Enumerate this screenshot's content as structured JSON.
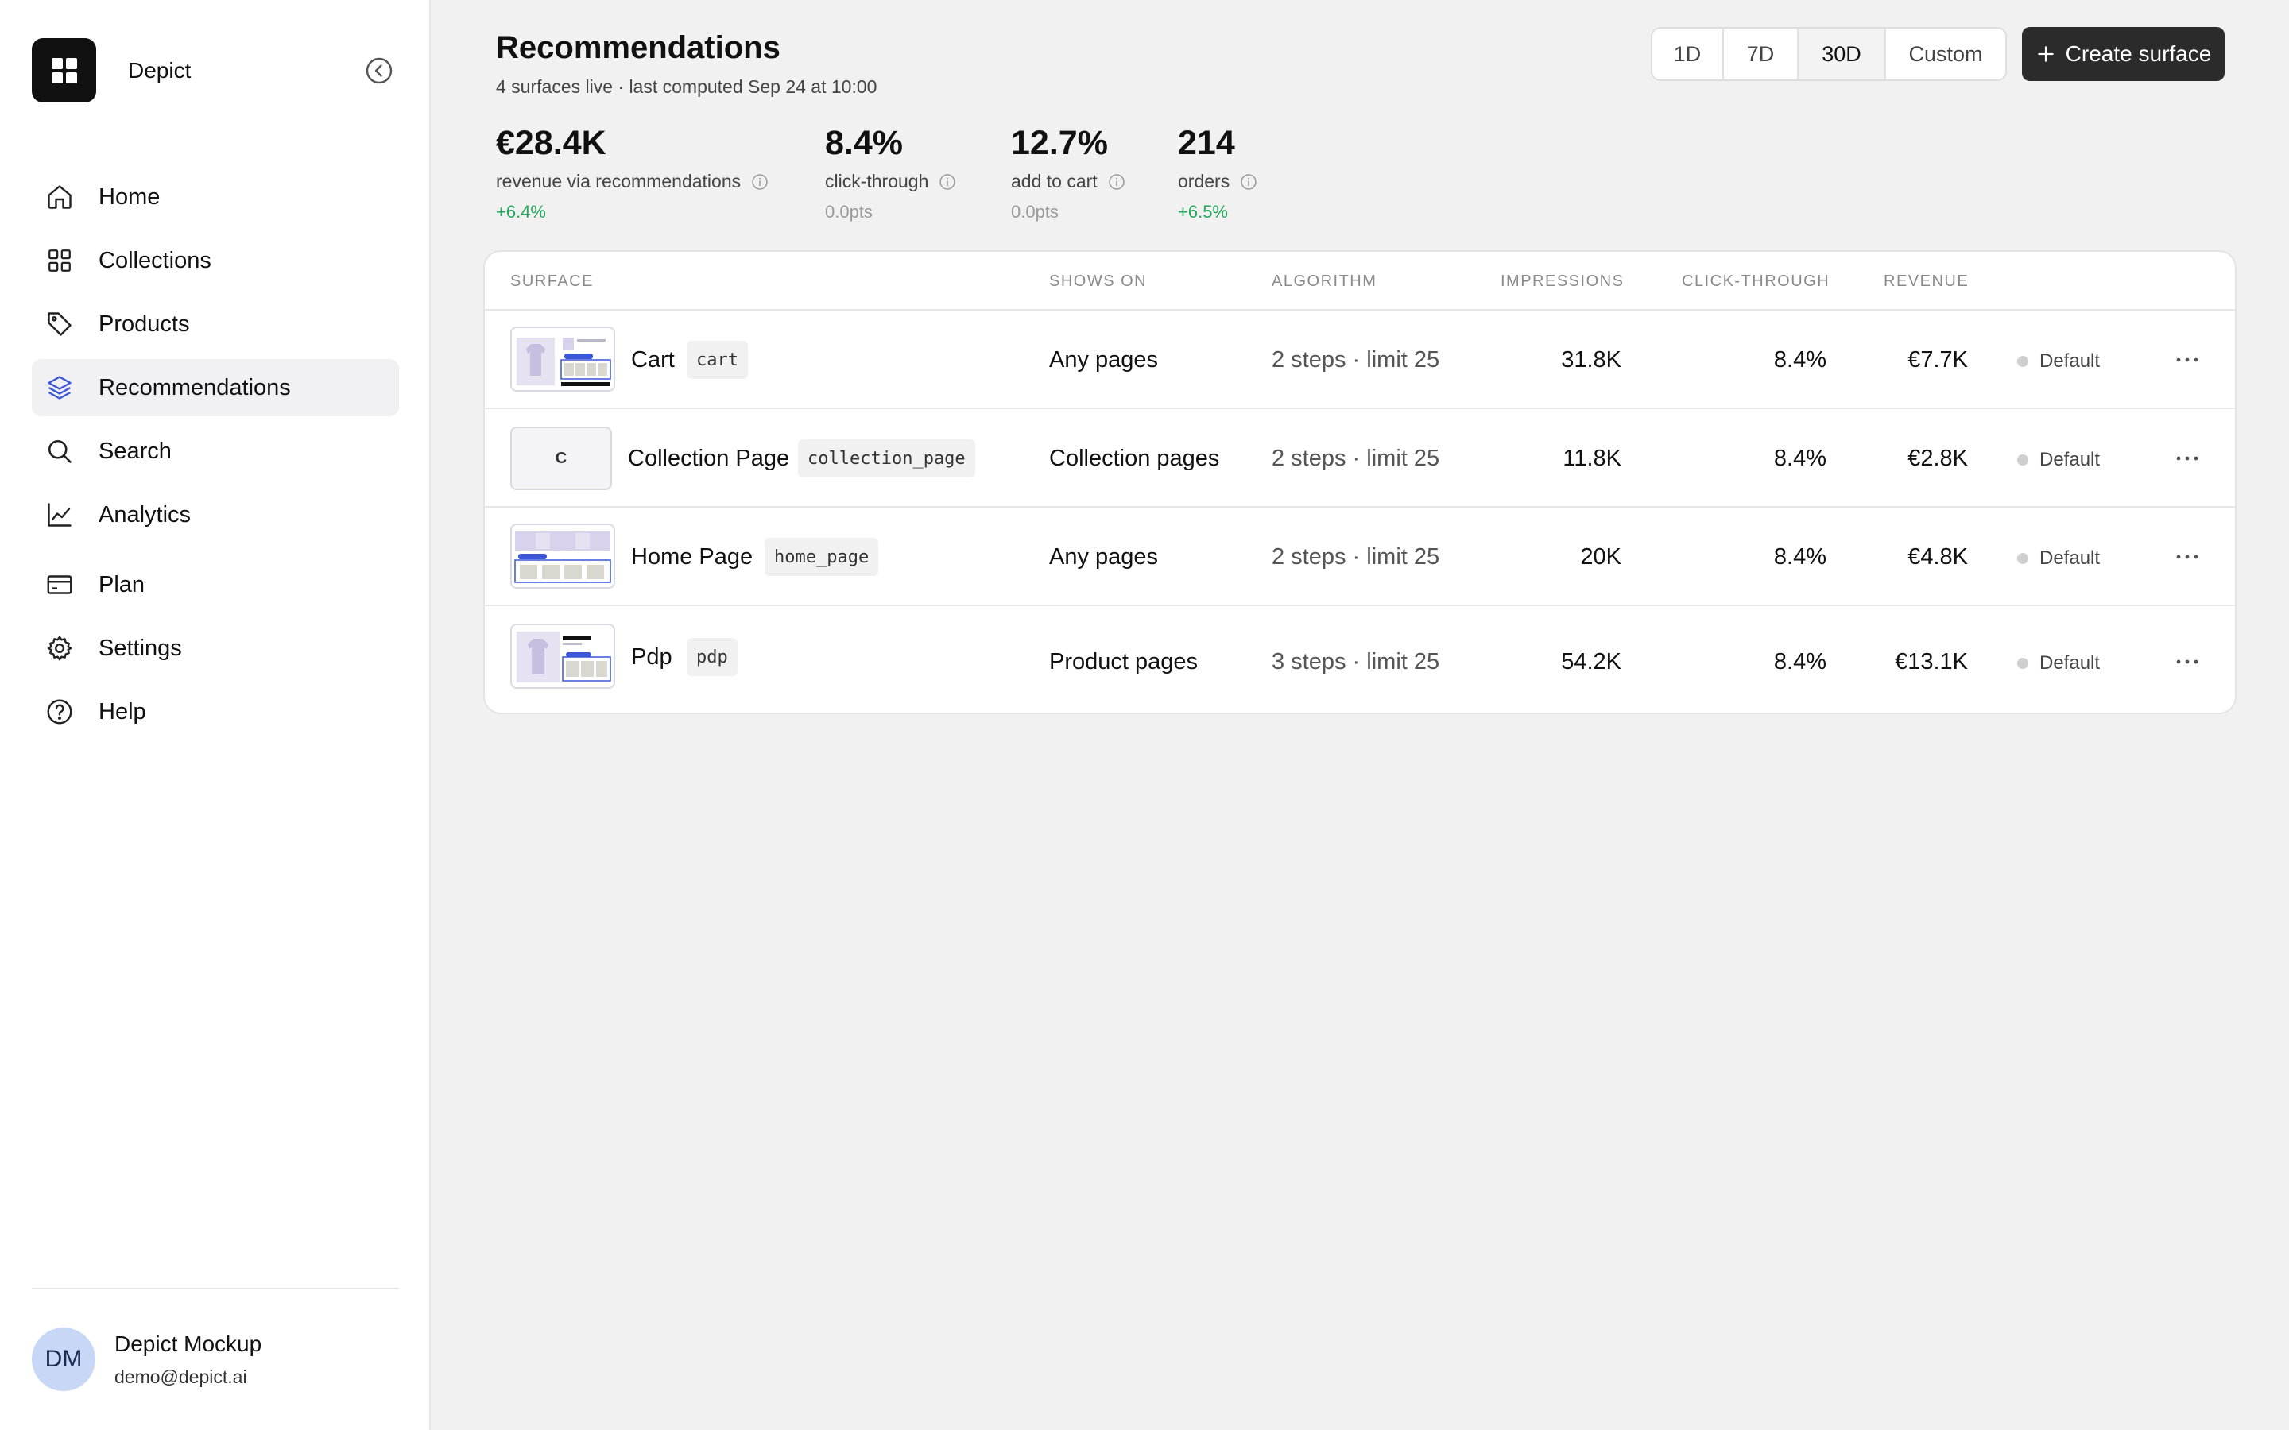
{
  "sidebar": {
    "brand_name": "Depict",
    "nav": [
      {
        "label": "Home",
        "icon": "home-icon"
      },
      {
        "label": "Collections",
        "icon": "grid-icon"
      },
      {
        "label": "Products",
        "icon": "tag-icon"
      },
      {
        "label": "Recommendations",
        "icon": "layers-icon",
        "active": true
      },
      {
        "label": "Search",
        "icon": "search-icon"
      },
      {
        "label": "Analytics",
        "icon": "line-chart-icon"
      },
      {
        "label": "Plan",
        "icon": "credit-card-icon"
      },
      {
        "label": "Settings",
        "icon": "gear-icon"
      },
      {
        "label": "Help",
        "icon": "help-circle-icon"
      }
    ],
    "user": {
      "initials": "DM",
      "name": "Depict Mockup",
      "email": "demo@depict.ai"
    }
  },
  "header": {
    "title": "Recommendations",
    "subtitle": "4 surfaces live · last computed Sep 24 at 10:00",
    "ranges": [
      "1D",
      "7D",
      "30D",
      "Custom"
    ],
    "selected_range": "30D",
    "create_label": "Create surface"
  },
  "metrics": [
    {
      "value": "€28.4K",
      "label": "revenue via recommendations",
      "delta": "+6.4%"
    },
    {
      "value": "8.4%",
      "label": "click-through",
      "delta": "0.0pts"
    },
    {
      "value": "12.7%",
      "label": "add to cart",
      "delta": "0.0pts"
    },
    {
      "value": "214",
      "label": "orders",
      "delta": "+6.5%"
    }
  ],
  "table": {
    "columns": [
      "SURFACE",
      "SHOWS ON",
      "ALGORITHM",
      "IMPRESSIONS",
      "CLICK-THROUGH",
      "REVENUE"
    ],
    "rows": [
      {
        "name": "Cart",
        "code": "cart",
        "thumb": "cart",
        "shows_on": "Any pages",
        "algorithm": "2 steps · limit 25",
        "impressions": "31.8K",
        "ctr": "8.4%",
        "revenue": "€7.7K",
        "status": "Default"
      },
      {
        "name": "Collection Page",
        "code": "collection_page",
        "thumb": "C",
        "shows_on": "Collection pages",
        "algorithm": "2 steps · limit 25",
        "impressions": "11.8K",
        "ctr": "8.4%",
        "revenue": "€2.8K",
        "status": "Default"
      },
      {
        "name": "Home Page",
        "code": "home_page",
        "thumb": "home",
        "shows_on": "Any pages",
        "algorithm": "2 steps · limit 25",
        "impressions": "20K",
        "ctr": "8.4%",
        "revenue": "€4.8K",
        "status": "Default"
      },
      {
        "name": "Pdp",
        "code": "pdp",
        "thumb": "pdp",
        "shows_on": "Product pages",
        "algorithm": "3 steps · limit 25",
        "impressions": "54.2K",
        "ctr": "8.4%",
        "revenue": "€13.1K",
        "status": "Default"
      }
    ]
  }
}
